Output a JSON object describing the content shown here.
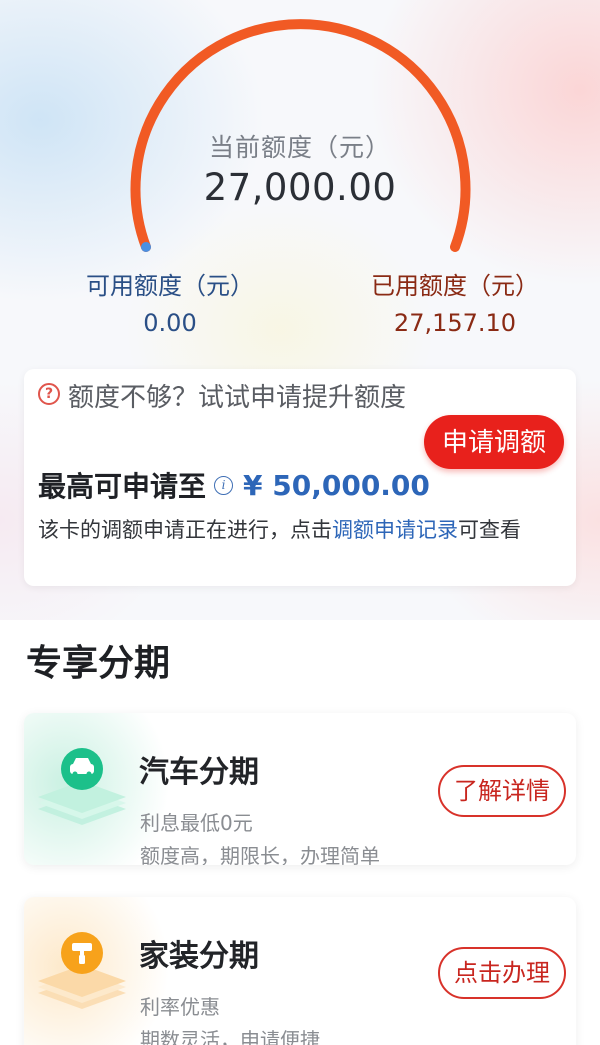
{
  "gauge": {
    "title": "当前额度（元）",
    "current_limit": "27,000.00",
    "available_label": "可用额度（元）",
    "available_value": "0.00",
    "used_label": "已用额度（元）",
    "used_value": "27,157.10",
    "arc_color": "#f15a24",
    "available_dot_color": "#4a90e2"
  },
  "credit_increase": {
    "prompt": "额度不够？试试申请提升额度",
    "apply_button": "申请调额",
    "max_label": "最高可申请至",
    "max_amount": "¥ 50,000.00",
    "status_prefix": "该卡的调额申请正在进行，点击",
    "status_link": "调额申请记录",
    "status_suffix": "可查看"
  },
  "installments": {
    "section_title": "专享分期",
    "items": [
      {
        "name": "汽车分期",
        "line1": "利息最低0元",
        "line2": "额度高，期限长，办理简单",
        "button": "了解详情",
        "icon": "car-icon",
        "accent": "#1cc08a"
      },
      {
        "name": "家装分期",
        "line1": "利率优惠",
        "line2": "期数灵活，申请便捷",
        "button": "点击办理",
        "icon": "paint-roller-icon",
        "accent": "#f7a21b"
      }
    ]
  }
}
